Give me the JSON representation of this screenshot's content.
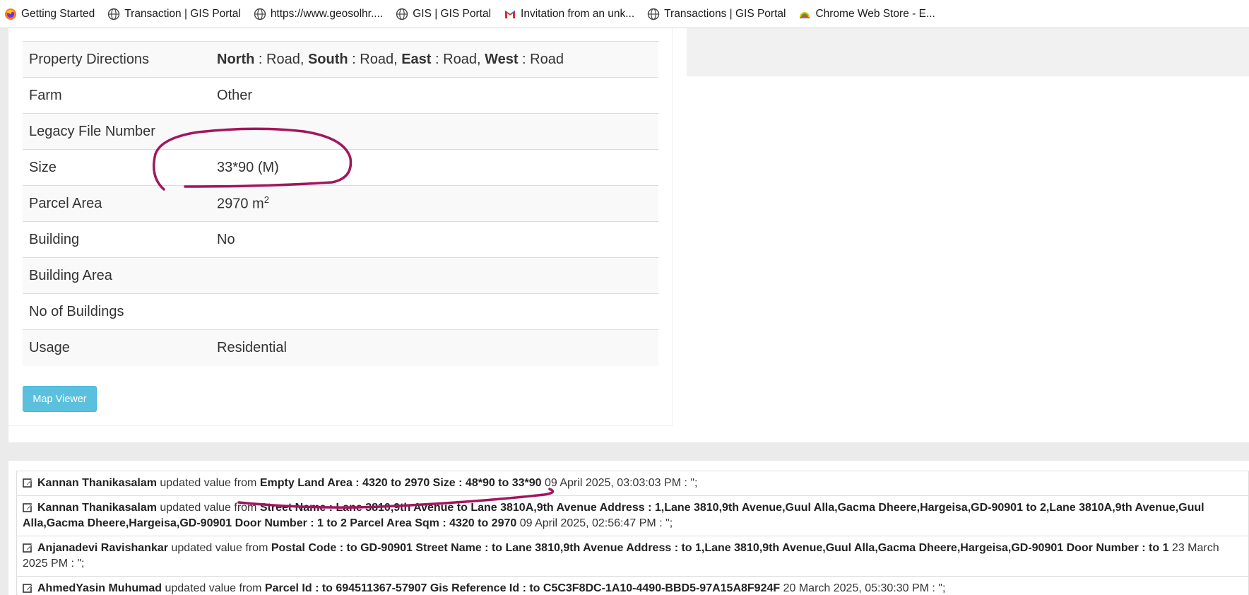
{
  "bookmarks": [
    {
      "label": "Getting Started",
      "icon": "firefox-icon"
    },
    {
      "label": "Transaction | GIS Portal",
      "icon": "globe-icon"
    },
    {
      "label": "https://www.geosolhr....",
      "icon": "globe-icon"
    },
    {
      "label": "GIS | GIS Portal",
      "icon": "globe-icon"
    },
    {
      "label": "Invitation from an unk...",
      "icon": "gmail-icon"
    },
    {
      "label": "Transactions | GIS Portal",
      "icon": "globe-icon"
    },
    {
      "label": "Chrome Web Store - E...",
      "icon": "chrome-web-store-icon"
    }
  ],
  "property": {
    "rows": [
      {
        "label": "Property Directions"
      },
      {
        "label": "Farm",
        "value": "Other"
      },
      {
        "label": "Legacy File Number",
        "value": ""
      },
      {
        "label": "Size",
        "value": "33*90 (M)"
      },
      {
        "label": "Parcel Area",
        "value": "2970 m",
        "sup": "2"
      },
      {
        "label": "Building",
        "value": "No"
      },
      {
        "label": "Building Area",
        "value": ""
      },
      {
        "label": "No of Buildings",
        "value": ""
      },
      {
        "label": "Usage",
        "value": "Residential"
      }
    ],
    "directions": {
      "north_label": "North",
      "north_value": ": Road,",
      "south_label": "South",
      "south_value": ": Road,",
      "east_label": "East",
      "east_value": ": Road,",
      "west_label": "West",
      "west_value": ": Road"
    },
    "map_viewer_label": "Map Viewer"
  },
  "history": [
    {
      "user": "Kannan Thanikasalam",
      "action": "updated value from",
      "change": "Empty Land Area : 4320 to 2970 Size : 48*90 to 33*90",
      "timestamp": "09 April 2025, 03:03:03 PM : \";"
    },
    {
      "user": "Kannan Thanikasalam",
      "action": "updated value from",
      "change": "Street Name : Lane 3810,9th Avenue to Lane 3810A,9th Avenue Address : 1,Lane 3810,9th Avenue,Guul Alla,Gacma Dheere,Hargeisa,GD-90901 to 2,Lane 3810A,9th Avenue,Guul Alla,Gacma Dheere,Hargeisa,GD-90901 Door Number : 1 to 2 Parcel Area Sqm : 4320 to 2970",
      "timestamp": "09 April 2025, 02:56:47 PM : \";"
    },
    {
      "user": "Anjanadevi Ravishankar",
      "action": "updated value from",
      "change": "Postal Code : to GD-90901 Street Name : to Lane 3810,9th Avenue Address : to 1,Lane 3810,9th Avenue,Guul Alla,Gacma Dheere,Hargeisa,GD-90901 Door Number : to 1",
      "timestamp": "23 March 2025 PM : \";"
    },
    {
      "user": "AhmedYasin Muhumad",
      "action": "updated value from",
      "change": "Parcel Id : to 694511367-57907 Gis Reference Id : to C5C3F8DC-1A10-4490-BBD5-97A15A8F924F",
      "timestamp": "20 March 2025, 05:30:30 PM : \";"
    }
  ],
  "colors": {
    "annotation": "#a3155f",
    "button": "#5bc0de",
    "panel_bg": "#ebebeb"
  }
}
